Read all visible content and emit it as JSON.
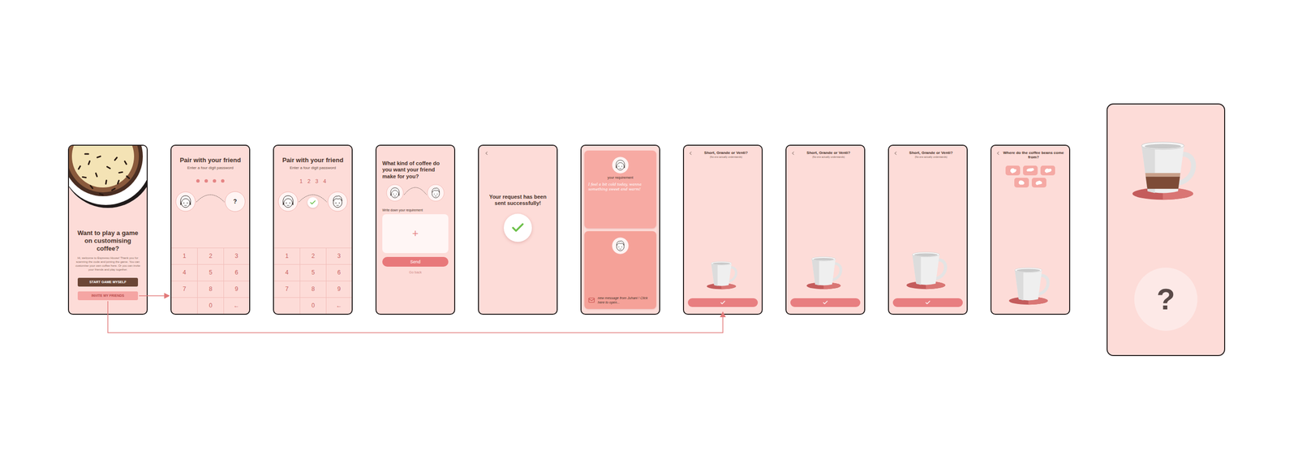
{
  "screens": [
    {
      "kind": "welcome",
      "title": "Want to play a game on customising coffee?",
      "body": "Hi, welcome to Espresso House! Thank you for scanning the code and joining the game. You can customise your own coffee here. Or you can invite your friends and play together.",
      "buttons": [
        {
          "label": "START GAME MYSELF",
          "kind": "primary"
        },
        {
          "label": "INVITE MY FRIENDS",
          "kind": "secondary"
        }
      ]
    },
    {
      "kind": "pair",
      "title": "Pair with your friend",
      "subtitle": "Enter a four digit password",
      "code": [
        "",
        "",
        "",
        ""
      ],
      "paired": false,
      "friend": "?",
      "keys": [
        "1",
        "2",
        "3",
        "4",
        "5",
        "6",
        "7",
        "8",
        "9",
        "",
        "0",
        "←"
      ]
    },
    {
      "kind": "pair",
      "title": "Pair with your friend",
      "subtitle": "Enter a four digit password",
      "code": [
        "1",
        "2",
        "3",
        "4"
      ],
      "paired": true,
      "friend": "?",
      "keys": [
        "1",
        "2",
        "3",
        "4",
        "5",
        "6",
        "7",
        "8",
        "9",
        "",
        "0",
        "←"
      ]
    },
    {
      "kind": "request",
      "title": "What kind of coffee do you want your friend make for you?",
      "label": "Write down your requirement",
      "add": "+",
      "send": "Send",
      "back": "Go back"
    },
    {
      "kind": "sent",
      "title": "Your request has been sent successfully!"
    },
    {
      "kind": "messages",
      "requirement_label": "your requirement",
      "requirement": "I feel a bit cold today, wanna something sweet and warm!",
      "message": "new message from Juhani ! Click here to open..."
    },
    {
      "kind": "size",
      "title": "Short, Grande or Venti?",
      "subtitle": "(No one actually understands)",
      "cup_size": "short"
    },
    {
      "kind": "size",
      "title": "Short, Grande or Venti?",
      "subtitle": "(No one actually understands)",
      "cup_size": "grande"
    },
    {
      "kind": "size",
      "title": "Short, Grande or Venti?",
      "subtitle": "(No one actually understands)",
      "cup_size": "venti"
    },
    {
      "kind": "origin",
      "title": "Where do the coffee beans come from?",
      "cup_size": "venti"
    },
    {
      "kind": "result",
      "mystery": "?",
      "level": 0.4
    }
  ]
}
